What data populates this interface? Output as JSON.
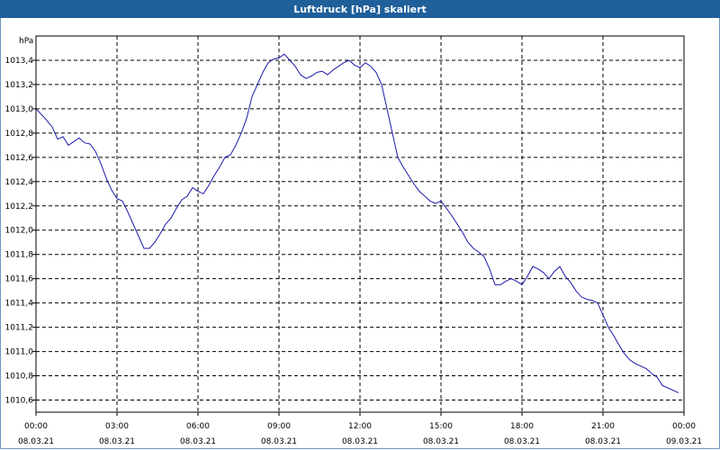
{
  "window": {
    "title": "Luftdruck [hPa] skaliert"
  },
  "colors": {
    "titlebar": "#1f5f9a",
    "line": "#1a1aa8",
    "grid": "#000000"
  },
  "chart_data": {
    "type": "line",
    "title": "Luftdruck [hPa] skaliert",
    "ylabel": "hPa",
    "xlabel": "",
    "ylim": [
      1010.5,
      1013.6
    ],
    "xlim_hours": [
      0,
      24
    ],
    "grid": true,
    "legend": "none",
    "y_ticks": [
      "1010,6",
      "1010,8",
      "1011,0",
      "1011,2",
      "1011,4",
      "1011,6",
      "1011,8",
      "1012,0",
      "1012,2",
      "1012,4",
      "1012,6",
      "1012,8",
      "1013,0",
      "1013,2",
      "1013,4"
    ],
    "x_ticks": [
      {
        "time": "00:00",
        "date": "08.03.21"
      },
      {
        "time": "03:00",
        "date": "08.03.21"
      },
      {
        "time": "06:00",
        "date": "08.03.21"
      },
      {
        "time": "09:00",
        "date": "08.03.21"
      },
      {
        "time": "12:00",
        "date": "08.03.21"
      },
      {
        "time": "15:00",
        "date": "08.03.21"
      },
      {
        "time": "18:00",
        "date": "08.03.21"
      },
      {
        "time": "21:00",
        "date": "08.03.21"
      },
      {
        "time": "00:00",
        "date": "09.03.21"
      }
    ],
    "series": [
      {
        "x_hours": [
          0.0,
          0.3,
          0.6,
          0.8,
          1.0,
          1.2,
          1.4,
          1.6,
          1.8,
          2.0,
          2.2,
          2.4,
          2.6,
          2.8,
          3.0,
          3.2,
          3.4,
          3.6,
          3.8,
          4.0,
          4.2,
          4.4,
          4.6,
          4.8,
          5.0,
          5.2,
          5.4,
          5.6,
          5.8,
          6.0,
          6.2,
          6.4,
          6.6,
          6.8,
          7.0,
          7.2,
          7.4,
          7.6,
          7.8,
          8.0,
          8.2,
          8.4,
          8.6,
          8.8,
          9.0,
          9.2,
          9.4,
          9.6,
          9.8,
          10.0,
          10.2,
          10.4,
          10.6,
          10.8,
          11.0,
          11.2,
          11.4,
          11.6,
          11.8,
          12.0,
          12.2,
          12.4,
          12.6,
          12.8,
          13.0,
          13.2,
          13.4,
          13.6,
          13.8,
          14.0,
          14.2,
          14.4,
          14.6,
          14.8,
          15.0,
          15.2,
          15.4,
          15.6,
          15.8,
          16.0,
          16.2,
          16.4,
          16.6,
          16.8,
          17.0,
          17.2,
          17.4,
          17.6,
          17.8,
          18.0,
          18.2,
          18.4,
          18.6,
          18.8,
          19.0,
          19.2,
          19.4,
          19.6,
          19.8,
          20.0,
          20.2,
          20.4,
          20.6,
          20.8,
          21.0,
          21.2,
          21.4,
          21.6,
          21.8,
          22.0,
          22.2,
          22.4,
          22.6,
          22.8,
          23.0,
          23.2,
          23.4,
          23.6,
          23.8
        ],
        "values": [
          1013.0,
          1012.93,
          1012.85,
          1012.75,
          1012.77,
          1012.7,
          1012.73,
          1012.76,
          1012.72,
          1012.71,
          1012.65,
          1012.55,
          1012.43,
          1012.33,
          1012.26,
          1012.24,
          1012.15,
          1012.05,
          1011.95,
          1011.85,
          1011.85,
          1011.9,
          1011.97,
          1012.05,
          1012.1,
          1012.18,
          1012.25,
          1012.28,
          1012.35,
          1012.32,
          1012.3,
          1012.37,
          1012.45,
          1012.52,
          1012.6,
          1012.62,
          1012.7,
          1012.8,
          1012.92,
          1013.1,
          1013.2,
          1013.3,
          1013.38,
          1013.41,
          1013.42,
          1013.45,
          1013.4,
          1013.35,
          1013.28,
          1013.25,
          1013.27,
          1013.3,
          1013.31,
          1013.28,
          1013.32,
          1013.35,
          1013.38,
          1013.4,
          1013.36,
          1013.34,
          1013.38,
          1013.35,
          1013.3,
          1013.2,
          1013.0,
          1012.8,
          1012.6,
          1012.52,
          1012.45,
          1012.38,
          1012.32,
          1012.28,
          1012.24,
          1012.22,
          1012.24,
          1012.18,
          1012.12,
          1012.05,
          1011.98,
          1011.9,
          1011.85,
          1011.82,
          1011.78,
          1011.68,
          1011.55,
          1011.55,
          1011.58,
          1011.6,
          1011.58,
          1011.55,
          1011.62,
          1011.7,
          1011.68,
          1011.65,
          1011.6,
          1011.66,
          1011.7,
          1011.62,
          1011.57,
          1011.5,
          1011.45,
          1011.43,
          1011.42,
          1011.4,
          1011.3,
          1011.2,
          1011.13,
          1011.05,
          1010.98,
          1010.93,
          1010.9,
          1010.88,
          1010.86,
          1010.82,
          1010.79,
          1010.72,
          1010.7,
          1010.68,
          1010.66
        ]
      }
    ]
  }
}
